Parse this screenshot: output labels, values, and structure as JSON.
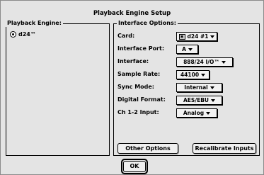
{
  "window": {
    "title": "Playback Engine Setup"
  },
  "playback_engine": {
    "group_title": "Playback Engine:",
    "selected_option": "d24™"
  },
  "interface_options": {
    "group_title": "Interface Options:",
    "rows": [
      {
        "label": "Card:",
        "value": "d24 #1"
      },
      {
        "label": "Interface Port:",
        "value": "A"
      },
      {
        "label": "Interface:",
        "value": "888/24 I/O™"
      },
      {
        "label": "Sample Rate:",
        "value": "44100"
      },
      {
        "label": "Sync Mode:",
        "value": "Internal"
      },
      {
        "label": "Digital Format:",
        "value": "AES/EBU"
      },
      {
        "label": "Ch 1-2 Input:",
        "value": "Analog"
      }
    ]
  },
  "buttons": {
    "other_options": "Other Options",
    "recalibrate_inputs": "Recalibrate Inputs",
    "ok": "OK"
  },
  "icons": {
    "card": "card-icon",
    "popup_arrow": "triangle-down-icon",
    "radio": "radio-selected-icon"
  }
}
